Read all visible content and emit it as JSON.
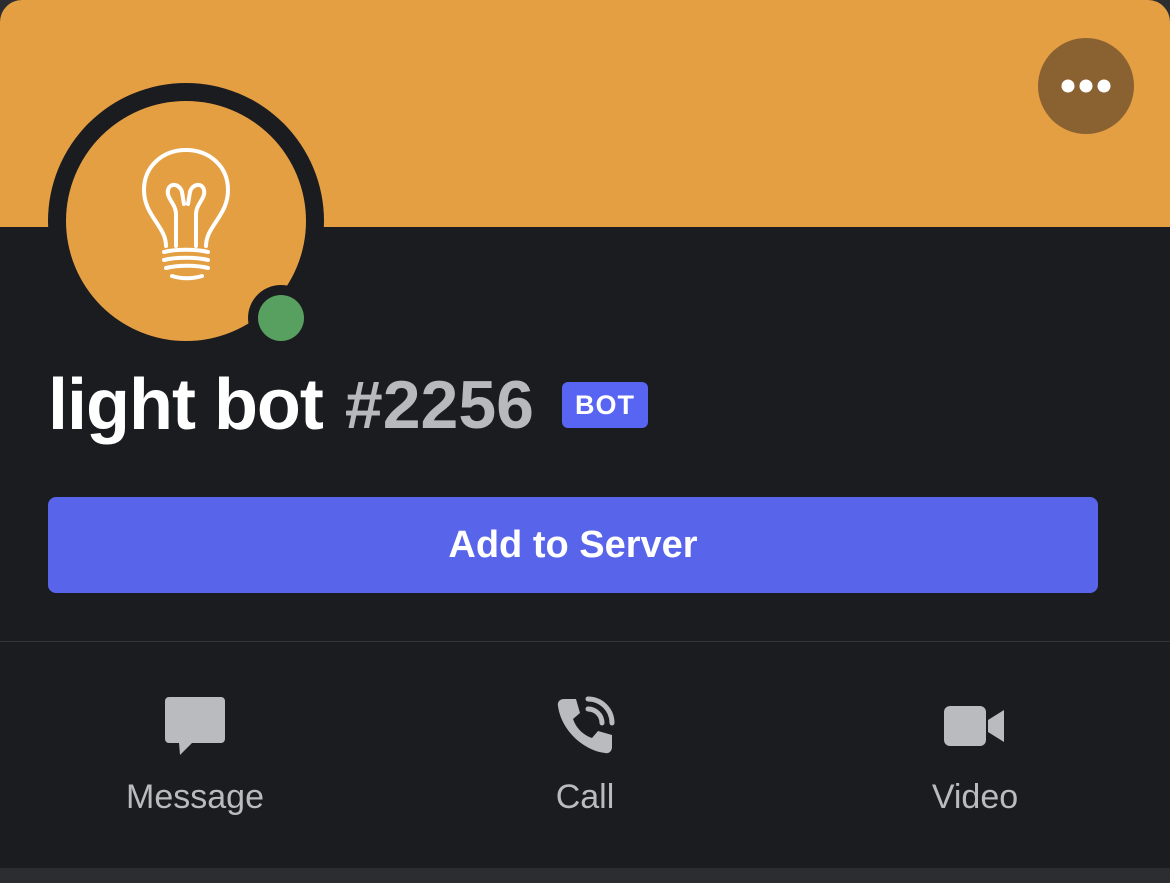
{
  "profile": {
    "username": "light bot",
    "discriminator": "#2256",
    "badge": "BOT",
    "status": "online",
    "avatar_icon": "lightbulb-icon",
    "banner_color": "#e49f43",
    "status_color": "#58a05f"
  },
  "header": {
    "more_icon": "more-horizontal-icon"
  },
  "primary_action": {
    "label": "Add to Server",
    "color": "#5865ea"
  },
  "actions": [
    {
      "label": "Message",
      "icon": "chat-bubble-icon"
    },
    {
      "label": "Call",
      "icon": "phone-call-icon"
    },
    {
      "label": "Video",
      "icon": "video-camera-icon"
    }
  ]
}
